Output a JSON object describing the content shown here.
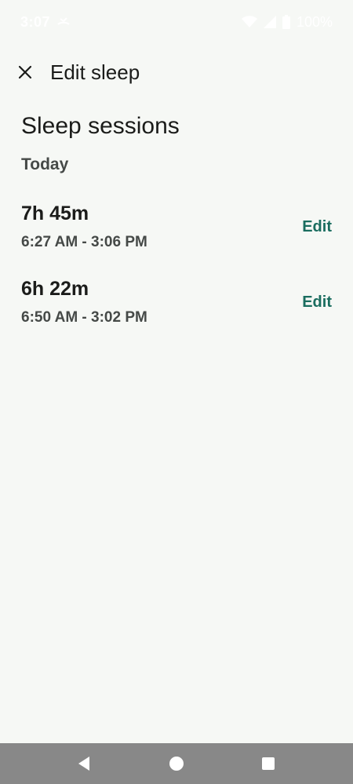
{
  "status_bar": {
    "time": "3:07",
    "battery": "100%"
  },
  "header": {
    "close_icon": "close-icon",
    "title": "Edit sleep"
  },
  "main": {
    "section_title": "Sleep sessions",
    "day_label": "Today",
    "sessions": [
      {
        "duration": "7h 45m",
        "range": "6:27 AM - 3:06 PM",
        "edit_label": "Edit"
      },
      {
        "duration": "6h 22m",
        "range": "6:50 AM - 3:02 PM",
        "edit_label": "Edit"
      }
    ]
  },
  "colors": {
    "background": "#f6f8f5",
    "accent": "#1a6d5f",
    "nav_bar": "#888888"
  }
}
